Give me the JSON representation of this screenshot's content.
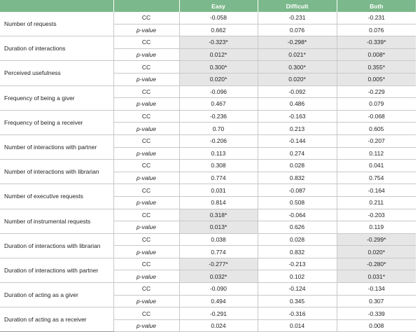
{
  "header": [
    "",
    "",
    "Easy",
    "Difficult",
    "Both"
  ],
  "rows": [
    {
      "variable": "Number of requests",
      "cc": [
        "-0.058",
        "-0.231",
        "-0.231"
      ],
      "p": [
        "0.662",
        "0.076",
        "0.076"
      ],
      "cc_sig": [
        false,
        false,
        false
      ],
      "p_sig": [
        false,
        false,
        false
      ]
    },
    {
      "variable": "Duration of interactions",
      "cc": [
        "-0.323*",
        "-0.298*",
        "-0.339*"
      ],
      "p": [
        "0.012*",
        "0.021*",
        "0.008*"
      ],
      "cc_sig": [
        true,
        true,
        true
      ],
      "p_sig": [
        true,
        true,
        true
      ]
    },
    {
      "variable": "Perceived usefulness",
      "cc": [
        "0.300*",
        "0.300*",
        "0.355*"
      ],
      "p": [
        "0.020*",
        "0.020*",
        "0.005*"
      ],
      "cc_sig": [
        true,
        true,
        true
      ],
      "p_sig": [
        true,
        true,
        true
      ]
    },
    {
      "variable": "Frequency of being a giver",
      "cc": [
        "-0.096",
        "-0.092",
        "-0.229"
      ],
      "p": [
        "0.467",
        "0.486",
        "0.079"
      ],
      "cc_sig": [
        false,
        false,
        false
      ],
      "p_sig": [
        false,
        false,
        false
      ]
    },
    {
      "variable": "Frequency of being a receiver",
      "cc": [
        "-0.236",
        "-0.163",
        "-0.068"
      ],
      "p": [
        "0.70",
        "0.213",
        "0.605"
      ],
      "cc_sig": [
        false,
        false,
        false
      ],
      "p_sig": [
        false,
        false,
        false
      ]
    },
    {
      "variable": "Number of interactions with partner",
      "cc": [
        "-0.206",
        "-0.144",
        "-0.207"
      ],
      "p": [
        "0.113",
        "0.274",
        "0.112"
      ],
      "cc_sig": [
        false,
        false,
        false
      ],
      "p_sig": [
        false,
        false,
        false
      ]
    },
    {
      "variable": "Number of interactions with librarian",
      "cc": [
        "0.308",
        "0.028",
        "0.041"
      ],
      "p": [
        "0.774",
        "0.832",
        "0.754"
      ],
      "cc_sig": [
        false,
        false,
        false
      ],
      "p_sig": [
        false,
        false,
        false
      ]
    },
    {
      "variable": "Number of executive requests",
      "cc": [
        "0.031",
        "-0.087",
        "-0.164"
      ],
      "p": [
        "0.814",
        "0.508",
        "0.211"
      ],
      "cc_sig": [
        false,
        false,
        false
      ],
      "p_sig": [
        false,
        false,
        false
      ]
    },
    {
      "variable": "Number of instrumental requests",
      "cc": [
        "0.318*",
        "-0.064",
        "-0.203"
      ],
      "p": [
        "0.013*",
        "0.626",
        "0.119"
      ],
      "cc_sig": [
        true,
        false,
        false
      ],
      "p_sig": [
        true,
        false,
        false
      ]
    },
    {
      "variable": "Duration of interactions with librarian",
      "cc": [
        "0.038",
        "0.028",
        "-0.299*"
      ],
      "p": [
        "0.774",
        "0.832",
        "0.020*"
      ],
      "cc_sig": [
        false,
        false,
        true
      ],
      "p_sig": [
        false,
        false,
        true
      ]
    },
    {
      "variable": "Duration of interactions with partner",
      "cc": [
        "-0.277*",
        "-0.213",
        "-0.280*"
      ],
      "p": [
        "0.032*",
        "0.102",
        "0.031*"
      ],
      "cc_sig": [
        true,
        false,
        true
      ],
      "p_sig": [
        true,
        false,
        true
      ]
    },
    {
      "variable": "Duration of acting as a giver",
      "cc": [
        "-0.090",
        "-0.124",
        "-0.134"
      ],
      "p": [
        "0.494",
        "0.345",
        "0.307"
      ],
      "cc_sig": [
        false,
        false,
        false
      ],
      "p_sig": [
        false,
        false,
        false
      ]
    },
    {
      "variable": "Duration of acting as a receiver",
      "cc": [
        "-0.291",
        "-0.316",
        "-0.339"
      ],
      "p": [
        "0.024",
        "0.014",
        "0.008"
      ],
      "cc_sig": [
        false,
        false,
        false
      ],
      "p_sig": [
        false,
        false,
        false
      ]
    }
  ],
  "labels": {
    "cc": "CC",
    "p": "p-value"
  },
  "colors": {
    "header_bg": "#7bb88b",
    "highlight_bg": "#e6e6e6",
    "rule": "#c8c8c8"
  }
}
